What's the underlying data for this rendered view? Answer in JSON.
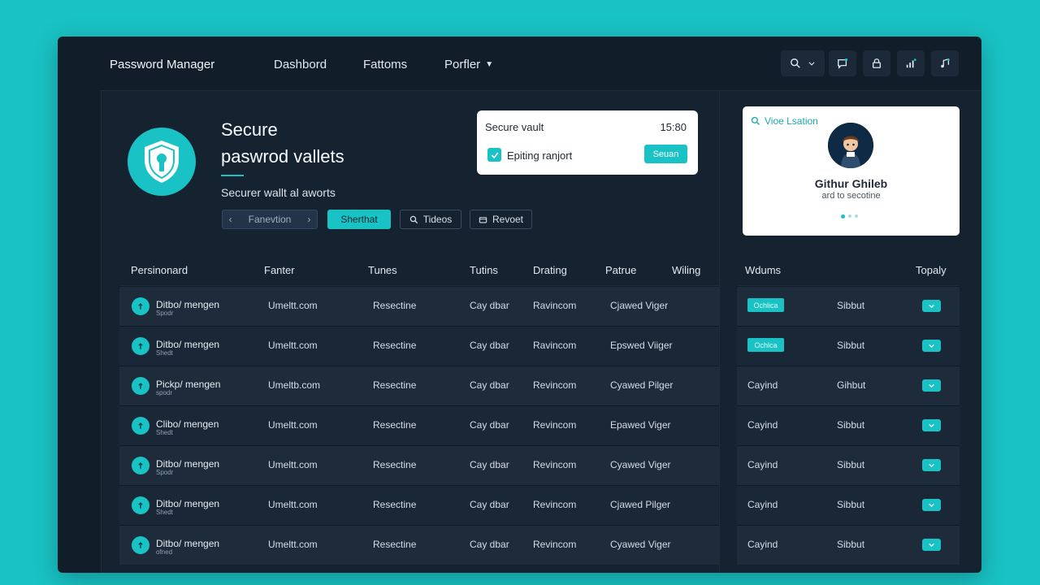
{
  "app": {
    "title": "Password Manager"
  },
  "nav": [
    {
      "label": "Dashbord"
    },
    {
      "label": "Fattoms"
    },
    {
      "label": "Porfler"
    }
  ],
  "hero": {
    "title_line1": "Secure",
    "title_line2": "paswrod vallets",
    "subtitle": "Securer wallt al aworts",
    "buttons": {
      "filter": "Fanevtion",
      "share": "Sherthat",
      "tideos": "Tideos",
      "revert": "Revoet"
    }
  },
  "vault_card": {
    "title": "Secure vault",
    "time": "15:80",
    "checkbox_label": "Epiting ranjort",
    "checked": true,
    "button": "Seuan"
  },
  "profile_card": {
    "search_label": "Vioe Lsation",
    "name": "Githur Ghileb",
    "subtitle": "ard to secotine",
    "carousel_active": 1
  },
  "main_table": {
    "headers": [
      "Persinonard",
      "Fanter",
      "Tunes",
      "Tutins",
      "Drating",
      "Patrue",
      "Wiling"
    ],
    "rows": [
      {
        "name": "Ditbo/ mengen",
        "sub": "Spodr",
        "email": "Umeltt.com",
        "col3": "Resectine",
        "col4": "Cay dbar",
        "col5": "Ravincom",
        "col6": "Cjawed Viger"
      },
      {
        "name": "Ditbo/ mengen",
        "sub": "Shedt",
        "email": "Umeltt.com",
        "col3": "Resectine",
        "col4": "Cay dbar",
        "col5": "Ravincom",
        "col6": "Epswed Viiger"
      },
      {
        "name": "Pickp/ mengen",
        "sub": "spodr",
        "email": "Umeltb.com",
        "col3": "Resectine",
        "col4": "Cay dbar",
        "col5": "Revincom",
        "col6": "Cyawed Pilger"
      },
      {
        "name": "Clibo/ mengen",
        "sub": "Shedt",
        "email": "Umeltt.com",
        "col3": "Resectine",
        "col4": "Cay dbar",
        "col5": "Revincom",
        "col6": "Epawed Viger"
      },
      {
        "name": "Ditbo/ mengen",
        "sub": "Spodr",
        "email": "Umeltt.com",
        "col3": "Resectine",
        "col4": "Cay dbar",
        "col5": "Revincom",
        "col6": "Cyawed Viger"
      },
      {
        "name": "Ditbo/ mengen",
        "sub": "Shedt",
        "email": "Umeltt.com",
        "col3": "Resectine",
        "col4": "Cay dbar",
        "col5": "Revincom",
        "col6": "Cjawed Pilger"
      },
      {
        "name": "Ditbo/ mengen",
        "sub": "ofned",
        "email": "Umeltt.com",
        "col3": "Resectine",
        "col4": "Cay dbar",
        "col5": "Revincom",
        "col6": "Cyawed Viger"
      }
    ]
  },
  "side_table": {
    "headers": [
      "Wdums",
      "Topaly"
    ],
    "rows": [
      {
        "status": "Ochlica",
        "badge": true,
        "source": "Sibbut"
      },
      {
        "status": "Ochlca",
        "badge": true,
        "source": "Sibbut"
      },
      {
        "status": "Cayind",
        "badge": false,
        "source": "Gihbut"
      },
      {
        "status": "Cayind",
        "badge": false,
        "source": "Sibbut"
      },
      {
        "status": "Cayind",
        "badge": false,
        "source": "Sibbut"
      },
      {
        "status": "Cayind",
        "badge": false,
        "source": "Sibbut"
      },
      {
        "status": "Cayind",
        "badge": false,
        "source": "Sibbut"
      }
    ]
  },
  "colors": {
    "accent": "#19c2c4",
    "background": "#121d2a",
    "page": "#19c2c4"
  },
  "icons": [
    "search-icon",
    "chevron-down-icon",
    "chat-icon",
    "lock-icon",
    "signal-icon",
    "music-icon",
    "shield-icon",
    "check-icon",
    "key-icon"
  ]
}
